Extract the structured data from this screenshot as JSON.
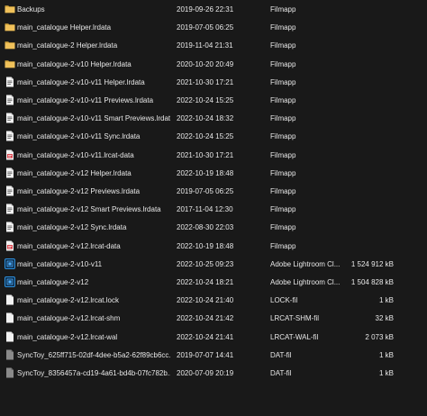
{
  "rows": [
    {
      "name": "Backups",
      "date": "2019-09-26 22:31",
      "type": "Filmapp",
      "size": "",
      "icon": "folder-icon"
    },
    {
      "name": "main_catalogue Helper.lrdata",
      "date": "2019-07-05 06:25",
      "type": "Filmapp",
      "size": "",
      "icon": "folder-icon"
    },
    {
      "name": "main_catalogue-2 Helper.lrdata",
      "date": "2019-11-04 21:31",
      "type": "Filmapp",
      "size": "",
      "icon": "folder-icon"
    },
    {
      "name": "main_catalogue-2-v10 Helper.lrdata",
      "date": "2020-10-20 20:49",
      "type": "Filmapp",
      "size": "",
      "icon": "folder-icon"
    },
    {
      "name": "main_catalogue-2-v10-v11 Helper.lrdata",
      "date": "2021-10-30 17:21",
      "type": "Filmapp",
      "size": "",
      "icon": "lrdata-icon"
    },
    {
      "name": "main_catalogue-2-v10-v11 Previews.lrdata",
      "date": "2022-10-24 15:25",
      "type": "Filmapp",
      "size": "",
      "icon": "lrdata-icon"
    },
    {
      "name": "main_catalogue-2-v10-v11 Smart Previews.lrdata",
      "date": "2022-10-24 18:32",
      "type": "Filmapp",
      "size": "",
      "icon": "lrdata-icon"
    },
    {
      "name": "main_catalogue-2-v10-v11 Sync.lrdata",
      "date": "2022-10-24 15:25",
      "type": "Filmapp",
      "size": "",
      "icon": "lrdata-icon"
    },
    {
      "name": "main_catalogue-2-v10-v11.lrcat-data",
      "date": "2021-10-30 17:21",
      "type": "Filmapp",
      "size": "",
      "icon": "lrcat-data-icon"
    },
    {
      "name": "main_catalogue-2-v12 Helper.lrdata",
      "date": "2022-10-19 18:48",
      "type": "Filmapp",
      "size": "",
      "icon": "lrdata-icon"
    },
    {
      "name": "main_catalogue-2-v12 Previews.lrdata",
      "date": "2019-07-05 06:25",
      "type": "Filmapp",
      "size": "",
      "icon": "lrdata-icon"
    },
    {
      "name": "main_catalogue-2-v12 Smart Previews.lrdata",
      "date": "2017-11-04 12:30",
      "type": "Filmapp",
      "size": "",
      "icon": "lrdata-icon"
    },
    {
      "name": "main_catalogue-2-v12 Sync.lrdata",
      "date": "2022-08-30 22:03",
      "type": "Filmapp",
      "size": "",
      "icon": "lrdata-icon"
    },
    {
      "name": "main_catalogue-2-v12.lrcat-data",
      "date": "2022-10-19 18:48",
      "type": "Filmapp",
      "size": "",
      "icon": "lrcat-data-icon"
    },
    {
      "name": "main_catalogue-2-v10-v11",
      "date": "2022-10-25 09:23",
      "type": "Adobe Lightroom Cl...",
      "size": "1 524 912 kB",
      "icon": "lightroom-catalog-icon"
    },
    {
      "name": "main_catalogue-2-v12",
      "date": "2022-10-24 18:21",
      "type": "Adobe Lightroom Cl...",
      "size": "1 504 828 kB",
      "icon": "lightroom-catalog-icon"
    },
    {
      "name": "main_catalogue-2-v12.lrcat.lock",
      "date": "2022-10-24 21:40",
      "type": "LOCK-fil",
      "size": "1 kB",
      "icon": "blank-file-icon"
    },
    {
      "name": "main_catalogue-2-v12.lrcat-shm",
      "date": "2022-10-24 21:42",
      "type": "LRCAT-SHM-fil",
      "size": "32 kB",
      "icon": "blank-file-icon"
    },
    {
      "name": "main_catalogue-2-v12.lrcat-wal",
      "date": "2022-10-24 21:41",
      "type": "LRCAT-WAL-fil",
      "size": "2 073 kB",
      "icon": "blank-file-icon"
    },
    {
      "name": "SyncToy_625ff715-02df-4dee-b5a2-62f89cb6cc...",
      "date": "2019-07-07 14:41",
      "type": "DAT-fil",
      "size": "1 kB",
      "icon": "dat-file-icon"
    },
    {
      "name": "SyncToy_8356457a-cd19-4a61-bd4b-07fc782b...",
      "date": "2020-07-09 20:19",
      "type": "DAT-fil",
      "size": "1 kB",
      "icon": "dat-file-icon"
    }
  ],
  "colors": {
    "background": "#191919",
    "text": "#e8e8e8",
    "folder": "#e8b84a",
    "lrcat_red": "#d9474f",
    "lightroom_blue": "#2d8fdc"
  }
}
